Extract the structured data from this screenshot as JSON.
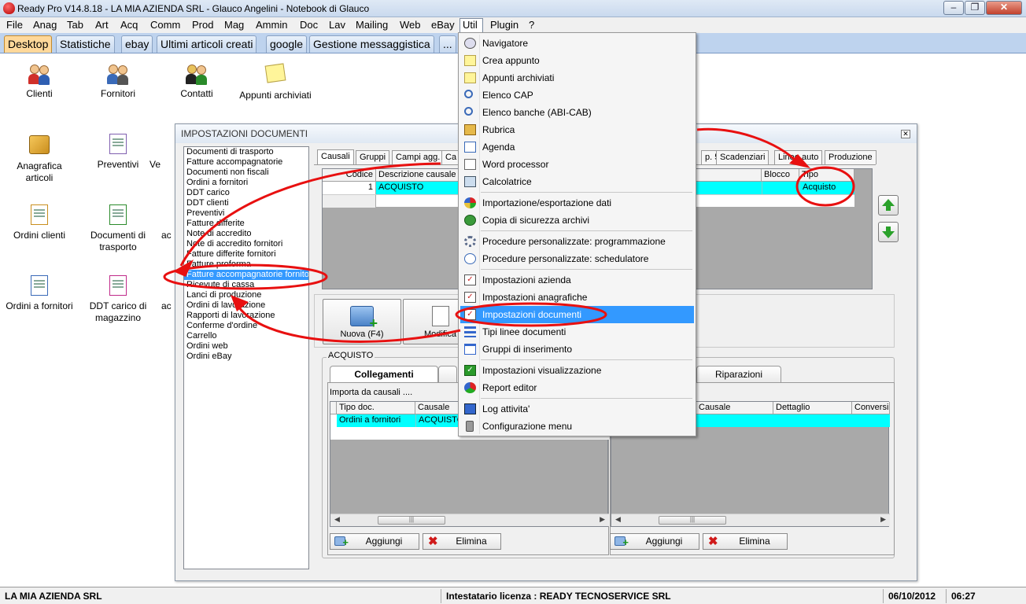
{
  "window": {
    "title": "Ready Pro V14.8.18 - LA MIA AZIENDA SRL - Glauco Angelini - Notebook di Glauco"
  },
  "menubar": [
    "File",
    "Anag",
    "Tab",
    "Art",
    "Acq",
    "Comm",
    "Prod",
    "Mag",
    "Ammin",
    "Doc",
    "Lav",
    "Mailing",
    "Web",
    "eBay",
    "Util",
    "Plugin",
    "?"
  ],
  "desktop_tabs": [
    "Desktop",
    "Statistiche",
    "ebay",
    "Ultimi articoli creati",
    "google",
    "Gestione messaggistica",
    "..."
  ],
  "desktop_icons": [
    {
      "label": "Clienti",
      "icon": "customers-icon"
    },
    {
      "label": "Fornitori",
      "icon": "suppliers-icon"
    },
    {
      "label": "Contatti",
      "icon": "contacts-icon"
    },
    {
      "label": "Appunti archiviati",
      "icon": "note-icon"
    },
    {
      "label": "Anagrafica articoli",
      "icon": "box-icon"
    },
    {
      "label": "Preventivi",
      "icon": "quote-icon"
    },
    {
      "label": "Ve",
      "icon": "doc-icon"
    },
    {
      "label": "Ordini clienti",
      "icon": "customer-orders-icon"
    },
    {
      "label": "Documenti di trasporto",
      "icon": "transport-doc-icon"
    },
    {
      "label": "ac",
      "icon": "doc-icon"
    },
    {
      "label": "Ordini a fornitori",
      "icon": "supplier-orders-icon"
    },
    {
      "label": "DDT carico di magazzino",
      "icon": "warehouse-ddt-icon"
    },
    {
      "label": "ac",
      "icon": "doc-icon"
    }
  ],
  "dialog": {
    "title": "IMPOSTAZIONI DOCUMENTI",
    "doc_types": [
      "Documenti di trasporto",
      "Fatture accompagnatorie",
      "Documenti non fiscali",
      "Ordini a fornitori",
      "DDT carico",
      "DDT clienti",
      "Preventivi",
      "Fatture differite",
      "Note di accredito",
      "Note di accredito fornitori",
      "Fatture differite fornitori",
      "Fatture proforma",
      "Fatture accompagnatorie fornitori",
      "Ricevute di cassa",
      "Lanci di produzione",
      "Ordini di lavorazione",
      "Rapporti di lavorazione",
      "Conferme d'ordine",
      "Carrello",
      "Ordini web",
      "Ordini eBay"
    ],
    "selected_doc_type": "Fatture accompagnatorie fornitori",
    "tabs": [
      "Causali",
      "Gruppi",
      "Campi agg.",
      "Ca",
      "p. 5",
      "Scadenziari",
      "Linee auto",
      "Produzione"
    ],
    "causali_grid": {
      "headers": [
        "Codice",
        "Descrizione causale",
        "Blocco",
        "Tipo"
      ],
      "row": {
        "codice": "1",
        "descrizione": "ACQUISTO",
        "blocco": "",
        "tipo": "Acquisto"
      }
    },
    "buttons": {
      "new": "Nuova (F4)",
      "edit": "Modifica"
    },
    "section_title": "ACQUISTO",
    "subtabs": [
      "Collegamenti",
      "Riparazioni"
    ],
    "left_panel": {
      "caption": "Importa da causali ....",
      "headers": [
        "Tipo doc.",
        "Causale"
      ],
      "row": [
        "Ordini a fornitori",
        "ACQUISTO"
      ],
      "add": "Aggiungi",
      "delete": "Elimina"
    },
    "right_panel": {
      "headers": [
        "Causale",
        "Dettaglio",
        "Conversi"
      ],
      "add": "Aggiungi",
      "delete": "Elimina"
    }
  },
  "util_menu": {
    "items": [
      {
        "label": "Navigatore",
        "icon": "navigator-icon"
      },
      {
        "label": "Crea appunto",
        "icon": "note-icon"
      },
      {
        "label": "Appunti archiviati",
        "icon": "note-icon"
      },
      {
        "label": "Elenco CAP",
        "icon": "magnifier-icon"
      },
      {
        "label": "Elenco banche (ABI-CAB)",
        "icon": "magnifier-icon"
      },
      {
        "label": "Rubrica",
        "icon": "address-book-icon"
      },
      {
        "label": "Agenda",
        "icon": "calendar-icon"
      },
      {
        "label": "Word processor",
        "icon": "document-icon"
      },
      {
        "label": "Calcolatrice",
        "icon": "calculator-icon"
      },
      {
        "label": "Importazione/esportazione dati",
        "icon": "sync-icon"
      },
      {
        "label": "Copia di sicurezza archivi",
        "icon": "backup-icon"
      },
      {
        "label": "Procedure personalizzate: programmazione",
        "icon": "gears-icon"
      },
      {
        "label": "Procedure personalizzate: schedulatore",
        "icon": "clock-icon"
      },
      {
        "label": "Impostazioni azienda",
        "icon": "checklist-icon"
      },
      {
        "label": "Impostazioni anagrafiche",
        "icon": "checklist-icon"
      },
      {
        "label": "Impostazioni documenti",
        "icon": "checklist-icon"
      },
      {
        "label": "Tipi linee documenti",
        "icon": "lines-icon"
      },
      {
        "label": "Gruppi di inserimento",
        "icon": "window-icon"
      },
      {
        "label": "Impostazioni visualizzazione",
        "icon": "check-icon"
      },
      {
        "label": "Report editor",
        "icon": "palette-icon"
      },
      {
        "label": "Log attivita'",
        "icon": "log-icon"
      },
      {
        "label": "Configurazione menu",
        "icon": "lock-icon"
      }
    ],
    "highlighted": "Impostazioni documenti"
  },
  "statusbar": {
    "company": "LA MIA AZIENDA SRL",
    "license": "Intestatario licenza : READY TECNOSERVICE SRL",
    "date": "06/10/2012",
    "time": "06:27"
  },
  "colors": {
    "annotation": "#e81010",
    "highlight": "#3399ff",
    "grid_row": "#00ffff"
  }
}
